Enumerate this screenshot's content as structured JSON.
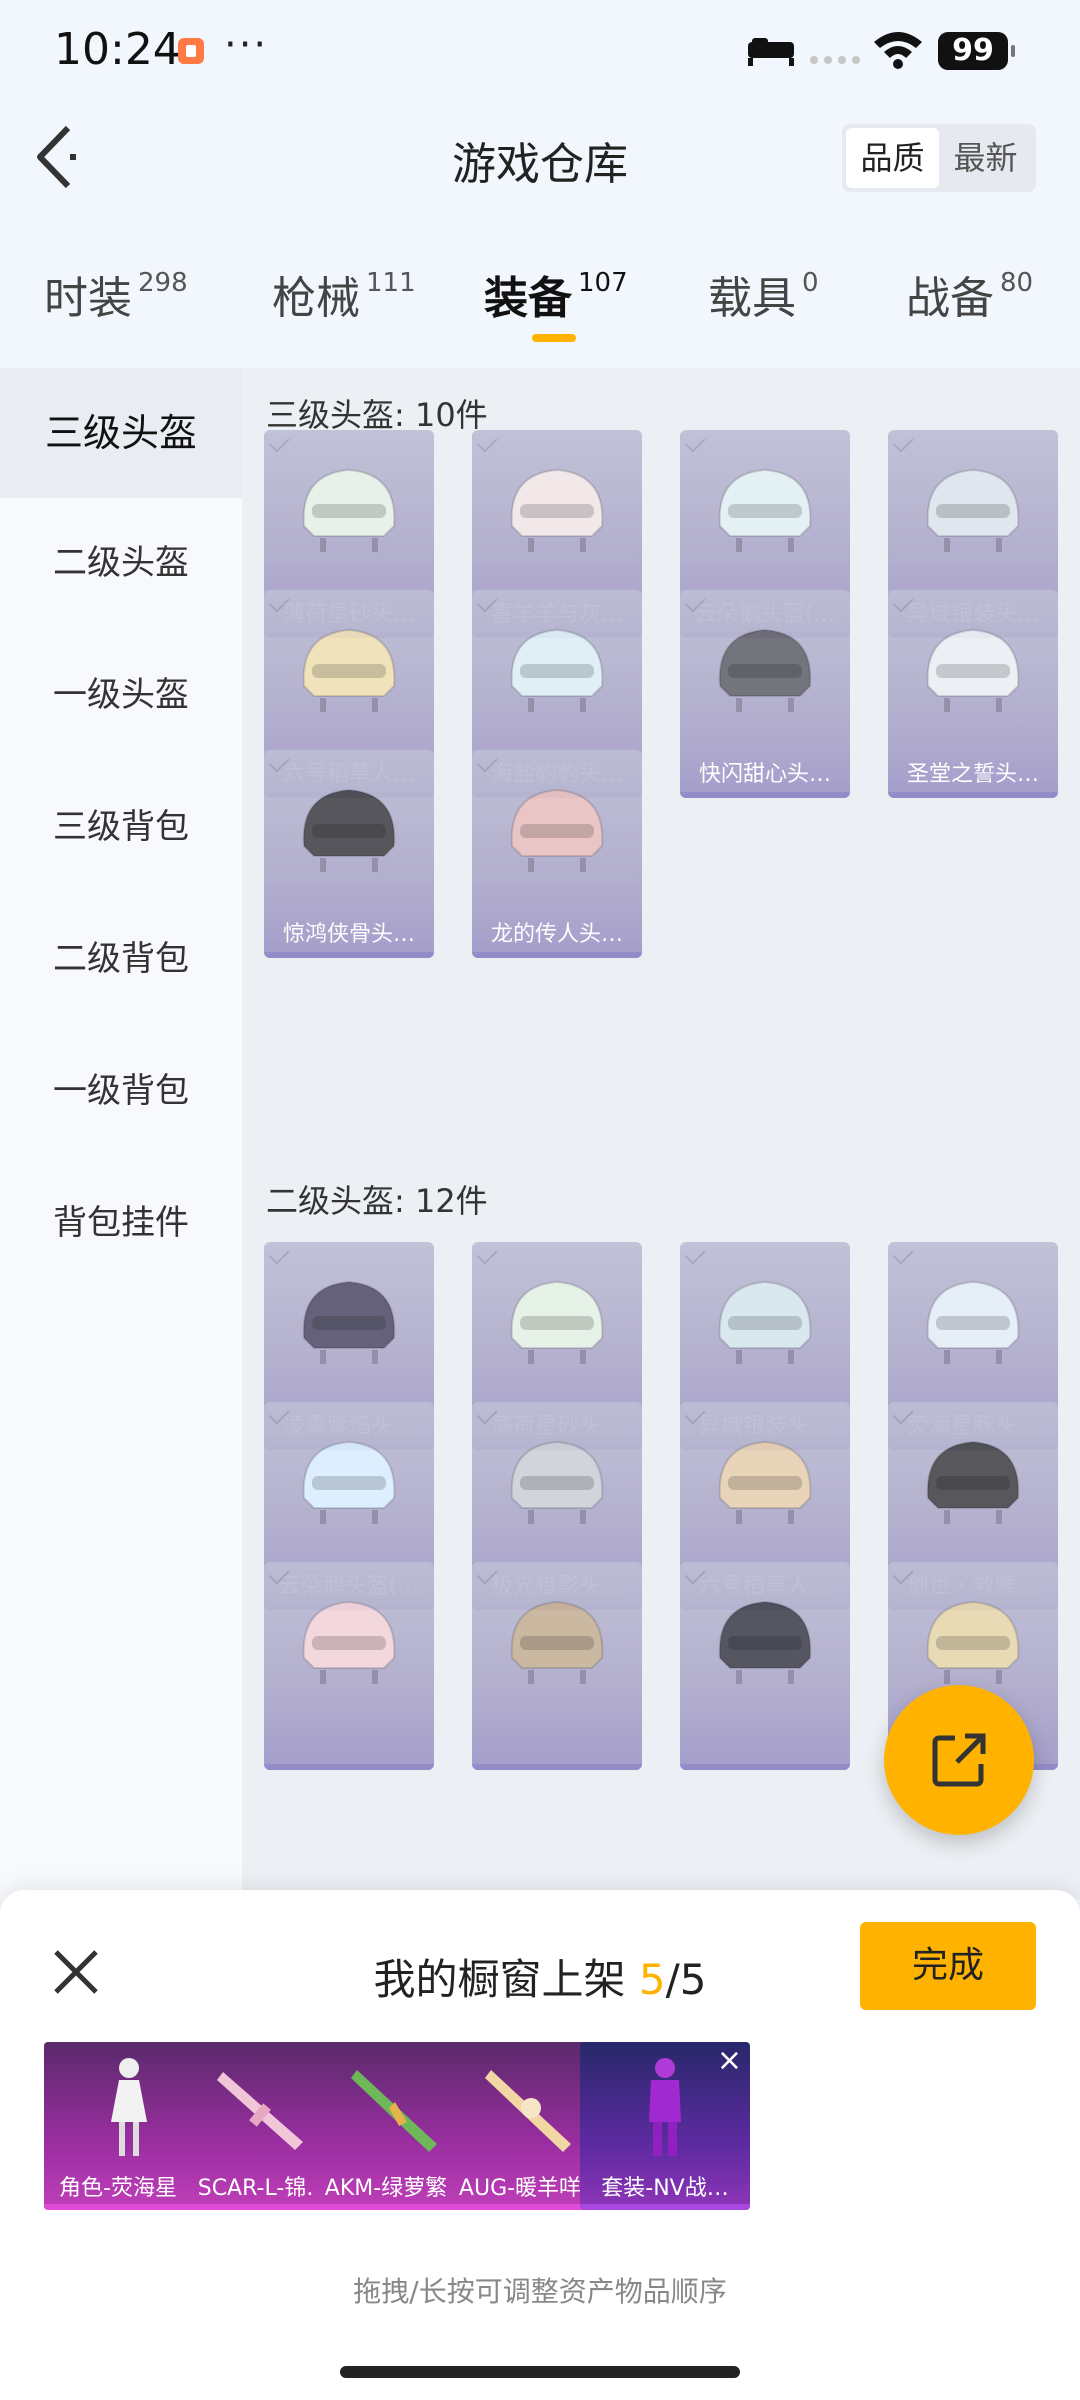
{
  "status_bar": {
    "time": "10:24",
    "dots": "···",
    "battery": "99"
  },
  "header": {
    "title": "游戏仓库",
    "sort_options": [
      "品质",
      "最新"
    ]
  },
  "tabs": [
    {
      "label": "时装",
      "count": "298"
    },
    {
      "label": "枪械",
      "count": "111"
    },
    {
      "label": "装备",
      "count": "107"
    },
    {
      "label": "载具",
      "count": "0"
    },
    {
      "label": "战备",
      "count": "80"
    }
  ],
  "sidebar": [
    "三级头盔",
    "二级头盔",
    "一级头盔",
    "三级背包",
    "二级背包",
    "一级背包",
    "背包挂件"
  ],
  "sections": [
    {
      "title": "三级头盔: 10件",
      "items": [
        "薄荷星砂头…",
        "喜羊羊与灰…",
        "云朵鹅头盔(…",
        "异域银装头…",
        "六号稻草人…",
        "海盐豹豹头…",
        "快闪甜心头…",
        "圣堂之誓头…",
        "惊鸿侠骨头…",
        "龙的传人头…"
      ]
    },
    {
      "title": "二级头盔: 12件",
      "items": [
        "凌霄紫焰头…",
        "薄荷星砂头…",
        "异域银装头…",
        "荧海星豚头…",
        "云朵鹅头盔(…",
        "极光猎影头…",
        "六号稻草人…",
        "创世・救赎…",
        "",
        "",
        "",
        ""
      ]
    }
  ],
  "showcase": {
    "title_prefix": "我的橱窗上架",
    "count": "5",
    "total": "/5",
    "done_label": "完成",
    "items": [
      "角色-荧海星豚",
      "SCAR-L-锦…",
      "AKM-绿萝繁花",
      "AUG-暖羊咩咩",
      "套装-NV战…"
    ],
    "hint": "拖拽/长按可调整资产物品顺序"
  },
  "colors": {
    "accent": "#ffb300",
    "card": "#aaa6cc",
    "showcase": "#b03cb0"
  }
}
